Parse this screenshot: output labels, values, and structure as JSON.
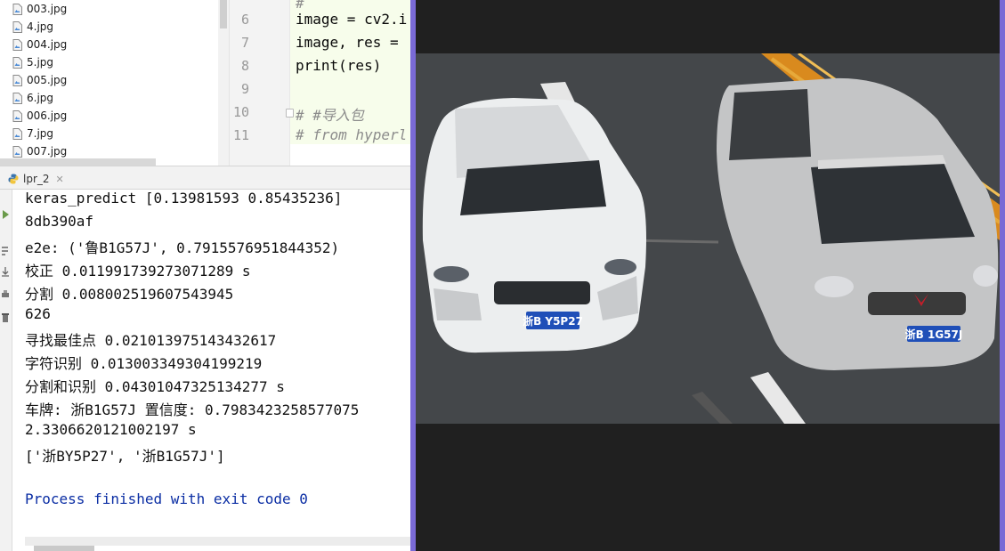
{
  "project_tree": {
    "files": [
      "003.jpg",
      "4.jpg",
      "004.jpg",
      "5.jpg",
      "005.jpg",
      "6.jpg",
      "006.jpg",
      "7.jpg",
      "007.jpg"
    ]
  },
  "editor": {
    "lines": [
      {
        "num": "6",
        "code": "image = cv2.i",
        "comment": false
      },
      {
        "num": "7",
        "code": "image, res =",
        "comment": false
      },
      {
        "num": "8",
        "code": "print(res)",
        "comment": false
      },
      {
        "num": "9",
        "code": "",
        "comment": false
      },
      {
        "num": "10",
        "code": "# #导入包",
        "comment": true
      },
      {
        "num": "11",
        "code": "# from hyperl",
        "comment": true
      }
    ]
  },
  "run_panel": {
    "tab_label": "lpr_2",
    "output": [
      "keras_predict [0.13981593 0.85435236]",
      "8db390af",
      "e2e: ('鲁B1G57J', 0.7915576951844352)",
      "校正 0.011991739273071289 s",
      "分割 0.008002519607543945",
      "626",
      "寻找最佳点 0.021013975143432617",
      "字符识别 0.013003349304199219",
      "分割和识别 0.04301047325134277 s",
      "车牌: 浙B1G57J 置信度: 0.7983423258577075",
      "2.3306620121002197 s",
      "['浙BY5P27', '浙B1G57J']",
      "",
      "Process finished with exit code 0"
    ]
  },
  "viewer": {
    "plate_left": "浙B Y5P27",
    "plate_right": "浙B 1G57J"
  },
  "colors": {
    "viewer_border": "#7a6ad6",
    "plate_blue": "#1f4fb8",
    "console_finish": "#0b2ea4"
  }
}
